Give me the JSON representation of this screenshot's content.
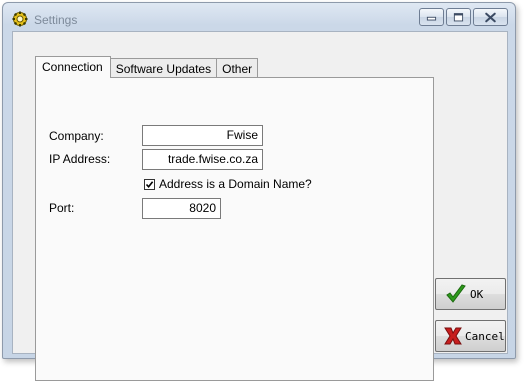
{
  "window": {
    "title": "Settings",
    "controls": {
      "minimize": "minimize-icon",
      "maximize": "maximize-icon",
      "close": "close-icon"
    }
  },
  "tabs": [
    {
      "label": "Connection",
      "active": true
    },
    {
      "label": "Software Updates",
      "active": false
    },
    {
      "label": "Other",
      "active": false
    }
  ],
  "form": {
    "company_label": "Company:",
    "company_value": "Fwise",
    "ip_label": "IP Address:",
    "ip_value": "trade.fwise.co.za",
    "domain_checkbox_label": "Address is a Domain Name?",
    "domain_checked": true,
    "port_label": "Port:",
    "port_value": "8020"
  },
  "buttons": {
    "ok_label": "OK",
    "cancel_label": "Cancel"
  },
  "colors": {
    "ok_check": "#2e9a1c",
    "cancel_x": "#c81e1e",
    "title_text": "#7d8a9a"
  }
}
